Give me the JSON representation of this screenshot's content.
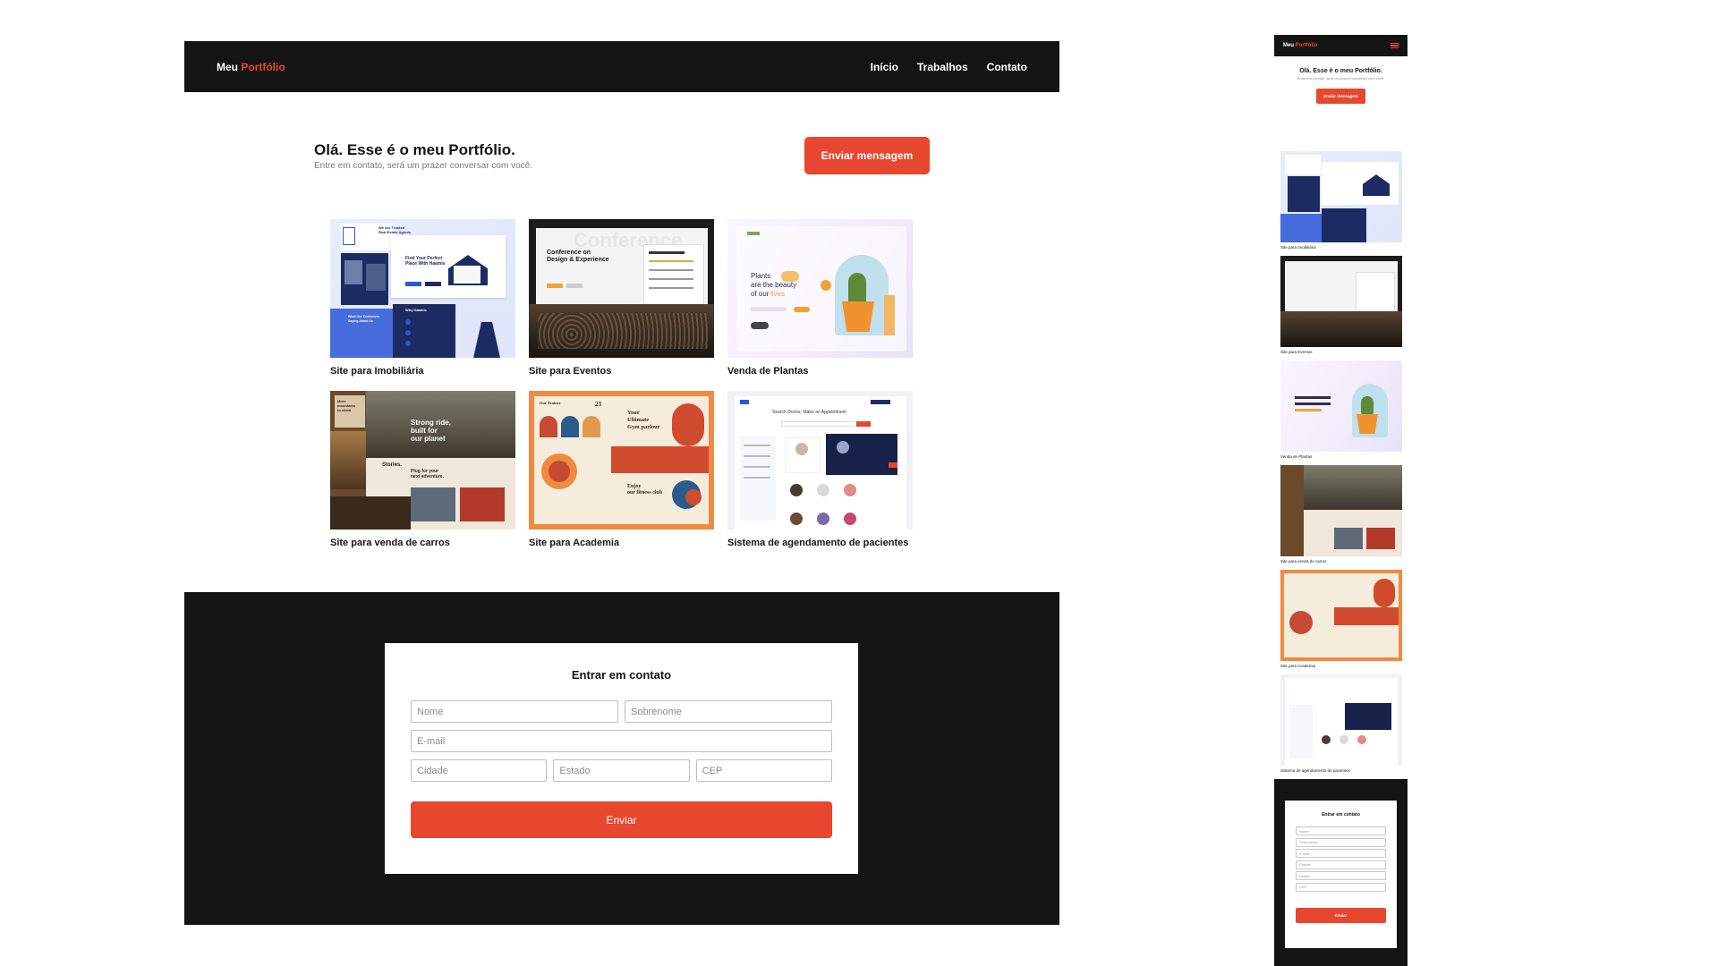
{
  "brand": {
    "prefix": "Meu",
    "accent": "Portfólio",
    "accent_color": "#e8472f",
    "dark_color": "#141414"
  },
  "nav": {
    "items": [
      "Início",
      "Trabalhos",
      "Contato"
    ]
  },
  "hero": {
    "title": "Olá. Esse é o meu Portfólio.",
    "subtitle": "Entre em contato, será um prazer conversar com você.",
    "cta_label": "Enviar mensagem"
  },
  "projects": [
    {
      "label": "Site para Imobiliária",
      "theme": "imobiliaria",
      "thumb_text": [
        "We Are Trusted",
        "Real Estate Agents",
        "Find Your Perfect",
        "Place With Haamis",
        "What Our Customers",
        "Saying About Us",
        "Why Haamis"
      ]
    },
    {
      "label": "Site para Eventos",
      "theme": "eventos",
      "thumb_text": [
        "Conference on",
        "Design & Experience",
        "Conference"
      ]
    },
    {
      "label": "Venda de Plantas",
      "theme": "plantas",
      "thumb_text": [
        "Plants",
        "are the beauty",
        "of our",
        "lives"
      ]
    },
    {
      "label": "Site para venda de carros",
      "theme": "carros",
      "thumb_text": [
        "More",
        "mountains",
        "to climb",
        "Strong ride,",
        "built for",
        "our planet",
        "Stories.",
        "Plug for your",
        "next adventure."
      ]
    },
    {
      "label": "Site para Academia",
      "theme": "academia",
      "thumb_text": [
        "Our Trainer",
        "Your",
        "Ultimate",
        "Gym parlour",
        "Enjoy",
        "our fitness club",
        "23"
      ]
    },
    {
      "label": "Sistema de agendamento de pacientes",
      "theme": "agendamento",
      "thumb_text": [
        "Search Doctor, Make an Appointment"
      ]
    }
  ],
  "contact": {
    "title": "Entrar em contato",
    "fields": {
      "first_name": "Nome",
      "last_name": "Sobrenome",
      "email": "E-mail",
      "city": "Cidade",
      "state": "Estado",
      "zip": "CEP"
    },
    "submit_label": "Enviar"
  },
  "icons": {
    "menu": "hamburger-menu-icon"
  }
}
